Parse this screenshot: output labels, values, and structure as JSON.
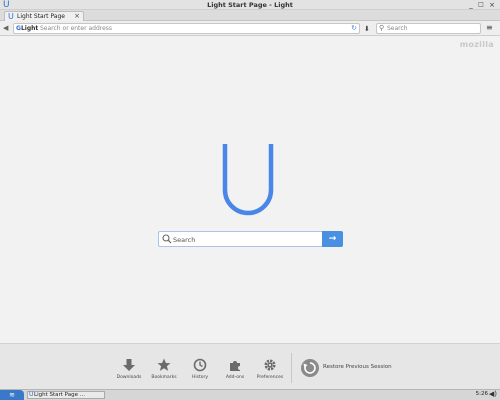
{
  "window": {
    "title": "Light Start Page - Light",
    "minimize_label": "_",
    "maximize_label": "□",
    "close_label": "×"
  },
  "tab": {
    "label": "Light Start Page",
    "close_label": "×",
    "new_tab_label": "+"
  },
  "navbar": {
    "brand_prefix": "G",
    "brand_name": "Light",
    "address_placeholder": "Search or enter address",
    "search_placeholder": "Search"
  },
  "content": {
    "watermark": "mozilla",
    "logo_letter": "U",
    "search_placeholder": "Search",
    "go_label": "→"
  },
  "launcher": {
    "items": [
      {
        "label": "Downloads",
        "icon": "download-icon"
      },
      {
        "label": "Bookmarks",
        "icon": "star-icon"
      },
      {
        "label": "History",
        "icon": "clock-icon"
      },
      {
        "label": "Add-ons",
        "icon": "puzzle-icon"
      },
      {
        "label": "Preferences",
        "icon": "gear-icon"
      }
    ],
    "restore_label": "Restore Previous Session"
  },
  "taskbar": {
    "task_label": "Light Start Page ...",
    "clock": "5:26"
  },
  "colors": {
    "accent": "#4a86e8",
    "go_button": "#4a90e2",
    "taskbar_start": "#3a78c9"
  }
}
